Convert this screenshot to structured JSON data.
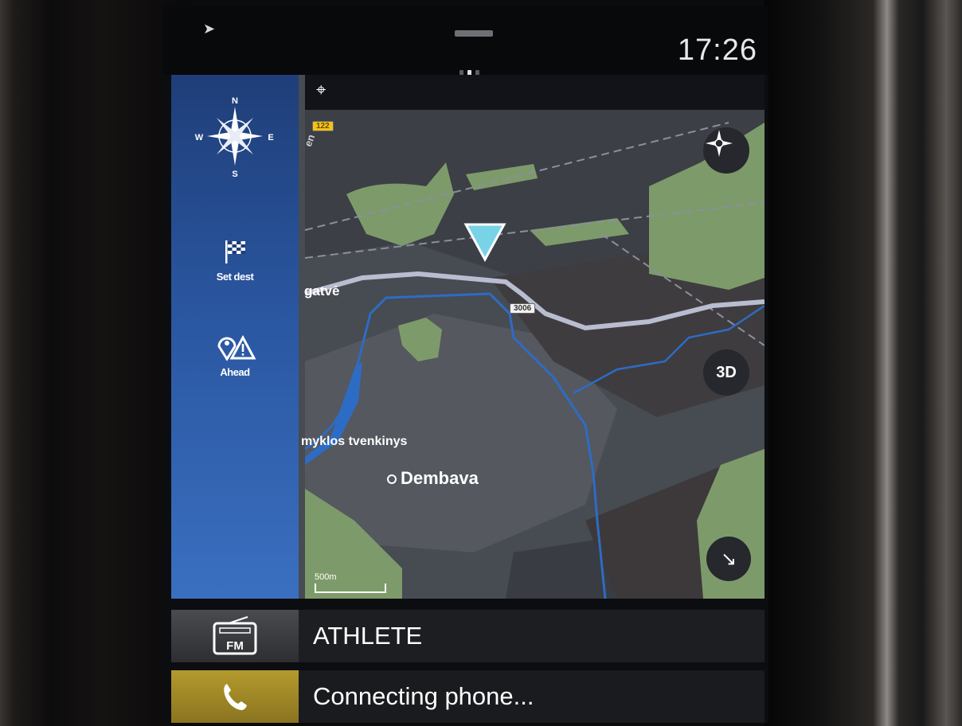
{
  "status": {
    "clock": "17:26"
  },
  "sidebar": {
    "items": [
      {
        "label": "",
        "icon": "compass-rose-icon"
      },
      {
        "label": "Set dest",
        "icon": "checkered-flag-icon"
      },
      {
        "label": "Ahead",
        "icon": "location-warning-icon"
      }
    ]
  },
  "map": {
    "street_label": "gatvė",
    "partial_road_label": "en",
    "pond_label": "myklos tvenkinys",
    "city_label": "Dembava",
    "road_shield_1": "3006",
    "road_shield_2": "122",
    "view_mode_button": "3D",
    "scale_label": "500m",
    "colors": {
      "land": "#474b52",
      "green": "#7d9b6a",
      "water": "#2d6cc4",
      "road": "#b9bdd0",
      "position": "#79d3e6"
    }
  },
  "media": {
    "source": "FM",
    "station": "ATHLETE",
    "source_icon": "radio-fm-icon"
  },
  "phone": {
    "status": "Connecting phone...",
    "icon": "phone-icon"
  }
}
